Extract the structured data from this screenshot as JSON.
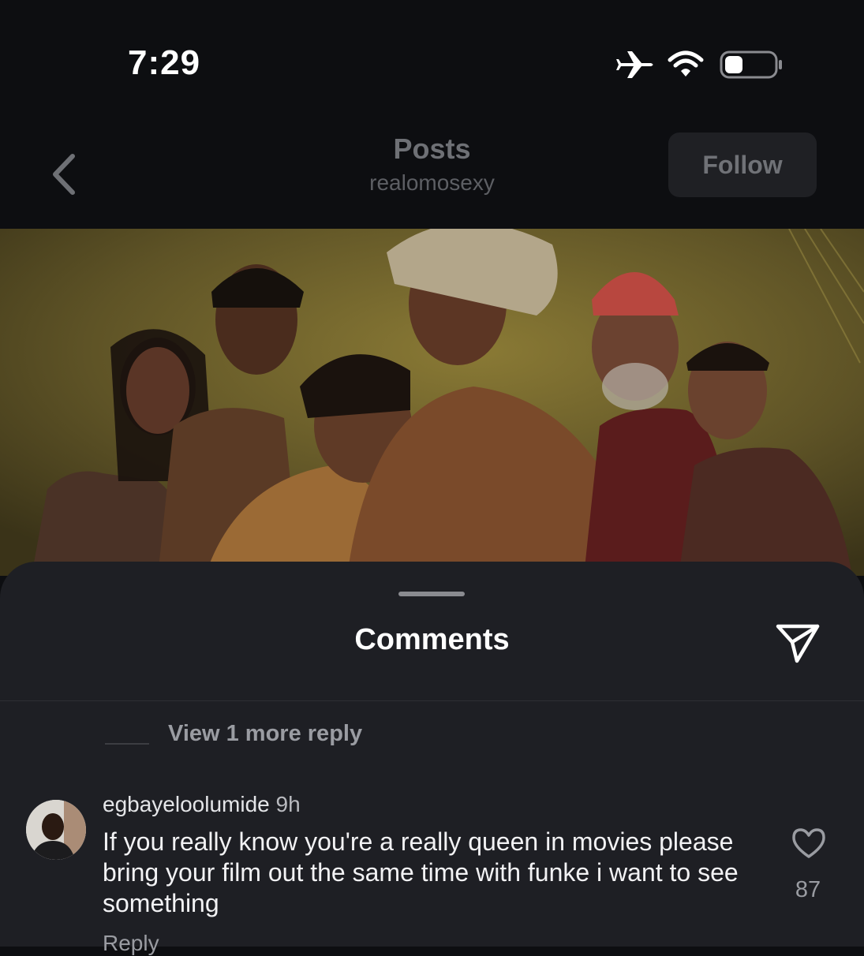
{
  "status_bar": {
    "time": "7:29",
    "icons": [
      "airplane-icon",
      "wifi-icon",
      "battery-icon"
    ]
  },
  "header": {
    "back_icon": "chevron-left-icon",
    "title": "Posts",
    "username": "realomosexy",
    "follow_label": "Follow"
  },
  "post": {
    "image_description": "Group portrait of six people on a yellow background"
  },
  "comments_sheet": {
    "title": "Comments",
    "share_icon": "paper-plane-icon",
    "view_more_replies": "View 1 more reply",
    "comment": {
      "username": "egbayeloolumide",
      "time": "9h",
      "text": "If you really know you're a really queen in movies please bring your film out the same time with funke i want to see something",
      "likes": "87",
      "reply_label": "Reply"
    }
  },
  "colors": {
    "background": "#0d0e11",
    "sheet": "#1e1f24",
    "muted_text": "#9a9ca2"
  }
}
